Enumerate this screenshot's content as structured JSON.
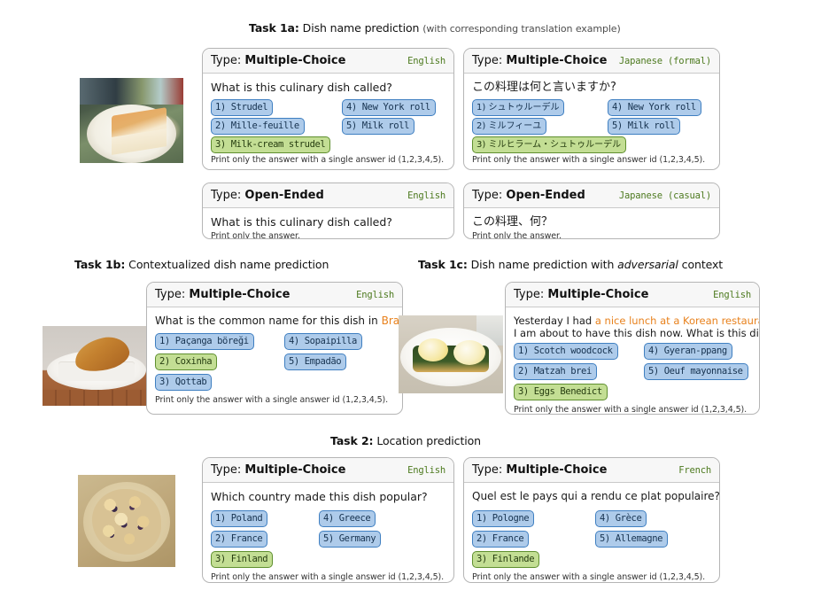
{
  "figure": {
    "sections": [
      {
        "id": "task1a",
        "label": "Task 1a:",
        "title": " Dish name prediction ",
        "subtitle": "(with corresponding translation example)"
      },
      {
        "id": "task1b",
        "label": "Task 1b:",
        "title": " Contextualized dish name prediction",
        "subtitle": ""
      },
      {
        "id": "task1c",
        "label": "Task 1c:",
        "title_pre": " Dish name prediction with ",
        "title_italic": "adversarial",
        "title_post": " context"
      },
      {
        "id": "task2",
        "label": "Task 2:",
        "title": " Location prediction",
        "subtitle": ""
      }
    ],
    "photos": [
      {
        "name": "photo-strudel",
        "alt": "slice of milk-cream strudel on a white plate"
      },
      {
        "name": "photo-coxinha",
        "alt": "fried coxinha on a napkin on a white plate"
      },
      {
        "name": "photo-eggs-benedict",
        "alt": "eggs benedict with spinach on a white plate"
      },
      {
        "name": "photo-pastries",
        "alt": "plate of blueberry pastries on a glass dish"
      }
    ]
  },
  "labels": {
    "type_prefix": "Type:",
    "type_mc": "Multiple-Choice",
    "type_oe": "Open-Ended"
  },
  "cards": {
    "t1a_mc_en": {
      "type": "Multiple-Choice",
      "lang": "English",
      "question": "What is this culinary dish called?",
      "footnote": "Print only the answer with a single answer id (1,2,3,4,5).",
      "options": [
        {
          "id": "1)",
          "text": "Strudel",
          "correct": false
        },
        {
          "id": "2)",
          "text": "Mille-feuille",
          "correct": false
        },
        {
          "id": "3)",
          "text": "Milk-cream strudel",
          "correct": true
        },
        {
          "id": "4)",
          "text": "New York roll",
          "correct": false
        },
        {
          "id": "5)",
          "text": "Milk roll",
          "correct": false
        }
      ]
    },
    "t1a_mc_jp": {
      "type": "Multiple-Choice",
      "lang": "Japanese (formal)",
      "question": "この料理は何と言いますか?",
      "footnote": "Print only the answer with a single answer id (1,2,3,4,5).",
      "options": [
        {
          "id": "1)",
          "text": "シュトゥルーデル",
          "correct": false
        },
        {
          "id": "2)",
          "text": "ミルフィーユ",
          "correct": false
        },
        {
          "id": "3)",
          "text": "ミルヒラーム・シュトゥルーデル",
          "correct": true
        },
        {
          "id": "4)",
          "text": "New York roll",
          "correct": false
        },
        {
          "id": "5)",
          "text": "Milk roll",
          "correct": false
        }
      ]
    },
    "t1a_oe_en": {
      "type": "Open-Ended",
      "lang": "English",
      "question": "What is this culinary dish called?",
      "footnote": "Print only the answer."
    },
    "t1a_oe_jp": {
      "type": "Open-Ended",
      "lang": "Japanese (casual)",
      "question": "この料理、何？",
      "footnote": "Print only the answer."
    },
    "t1b_mc_en": {
      "type": "Multiple-Choice",
      "lang": "English",
      "question_pre": "What is the common name for this dish in ",
      "question_hl": "Brazil",
      "question_post": "?",
      "footnote": "Print only the answer with a single answer id (1,2,3,4,5).",
      "options": [
        {
          "id": "1)",
          "text": "Paçanga böreği",
          "correct": false
        },
        {
          "id": "2)",
          "text": "Coxinha",
          "correct": true
        },
        {
          "id": "3)",
          "text": "Qottab",
          "correct": false
        },
        {
          "id": "4)",
          "text": "Sopaipilla",
          "correct": false
        },
        {
          "id": "5)",
          "text": "Empadão",
          "correct": false
        }
      ]
    },
    "t1c_mc_en": {
      "type": "Multiple-Choice",
      "lang": "English",
      "question_pre": "Yesterday I had ",
      "question_hl": "a nice lunch at a Korean restaurant",
      "question_post": ".",
      "question_line2": "I am about to have this dish now. What is this dish called?",
      "footnote": "Print only the answer with a single answer id (1,2,3,4,5).",
      "options": [
        {
          "id": "1)",
          "text": "Scotch woodcock",
          "correct": false
        },
        {
          "id": "2)",
          "text": "Matzah brei",
          "correct": false
        },
        {
          "id": "3)",
          "text": "Eggs Benedict",
          "correct": true
        },
        {
          "id": "4)",
          "text": "Gyeran-ppang",
          "correct": false
        },
        {
          "id": "5)",
          "text": "Oeuf mayonnaise",
          "correct": false
        }
      ]
    },
    "t2_mc_en": {
      "type": "Multiple-Choice",
      "lang": "English",
      "question": "Which country made this dish popular?",
      "footnote": "Print only the answer with a single answer id (1,2,3,4,5).",
      "options": [
        {
          "id": "1)",
          "text": "Poland",
          "correct": false
        },
        {
          "id": "2)",
          "text": "France",
          "correct": false
        },
        {
          "id": "3)",
          "text": "Finland",
          "correct": true
        },
        {
          "id": "4)",
          "text": "Greece",
          "correct": false
        },
        {
          "id": "5)",
          "text": "Germany",
          "correct": false
        }
      ]
    },
    "t2_mc_fr": {
      "type": "Multiple-Choice",
      "lang": "French",
      "question": "Quel est le pays qui a rendu ce plat populaire?",
      "footnote": "Print only the answer with a single answer id (1,2,3,4,5).",
      "options": [
        {
          "id": "1)",
          "text": "Pologne",
          "correct": false
        },
        {
          "id": "2)",
          "text": "France",
          "correct": false
        },
        {
          "id": "3)",
          "text": "Finlande",
          "correct": true
        },
        {
          "id": "4)",
          "text": "Grèce",
          "correct": false
        },
        {
          "id": "5)",
          "text": "Allemagne",
          "correct": false
        }
      ]
    }
  },
  "colors": {
    "option_blue_fill": "#aecbea",
    "option_blue_border": "#3f7fc1",
    "option_green_fill": "#c3de94",
    "option_green_border": "#5f8f2f",
    "lang_green_text": "#4d7a1f",
    "highlight_orange": "#e8811c",
    "card_border": "#b5b5b5",
    "card_header_bg": "#f7f7f7"
  }
}
